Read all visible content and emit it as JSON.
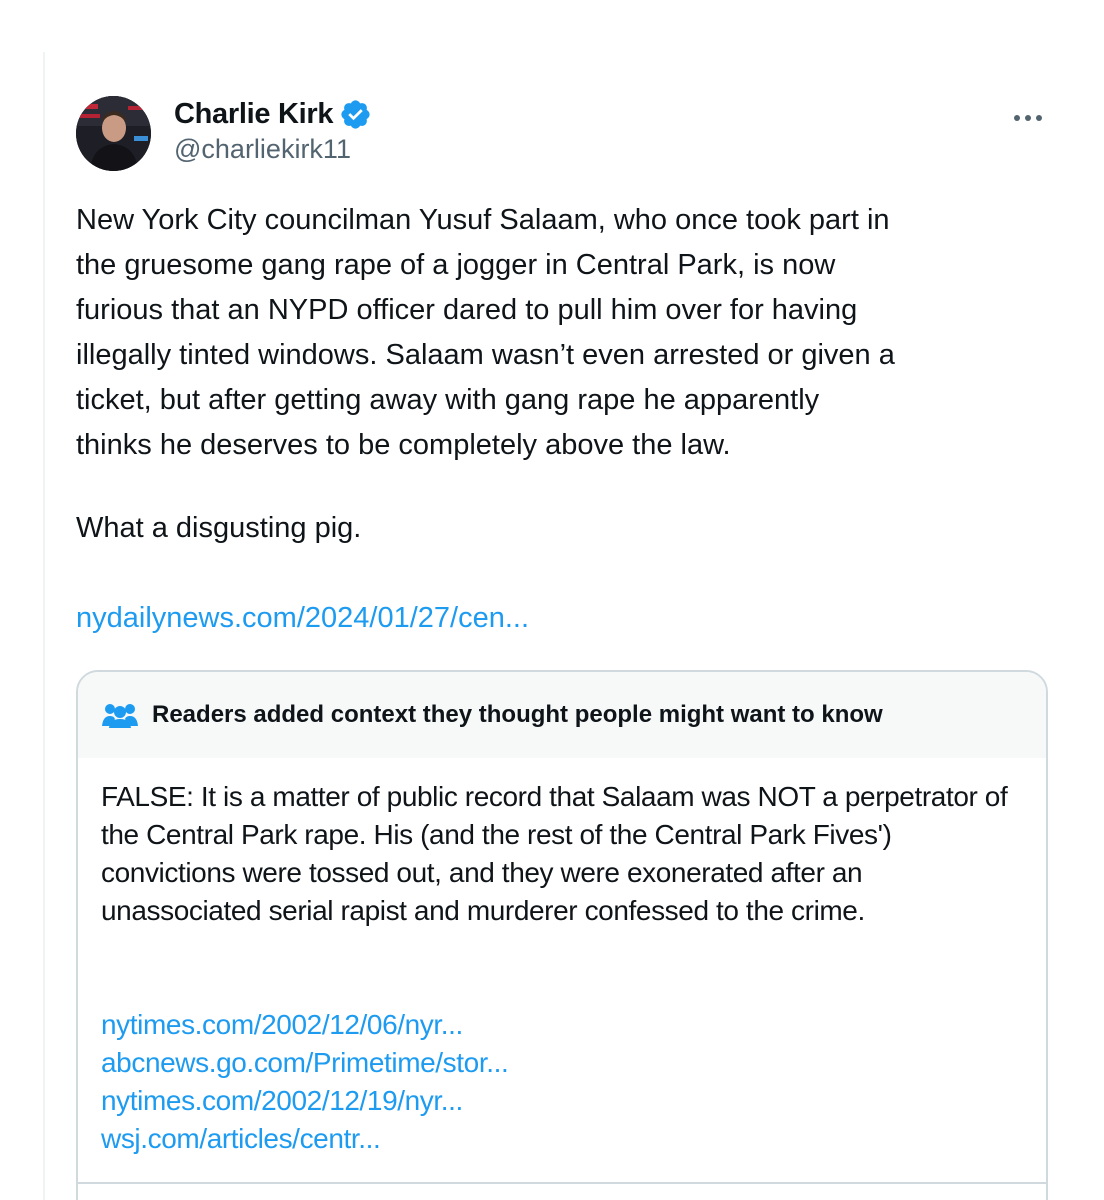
{
  "tweet": {
    "display_name": "Charlie Kirk",
    "handle": "@charliekirk11",
    "more_label": "•••",
    "body": "New York City councilman Yusuf Salaam, who once took part in\nthe gruesome gang rape of a jogger in Central Park, is now\nfurious that an NYPD officer dared to pull him over for having\nillegally tinted windows. Salaam wasn’t even arrested or given a\nticket, but after getting away with gang rape he apparently\nthinks he deserves to be completely above the law.",
    "closing": "What a disgusting pig.",
    "link": "nydailynews.com/2024/01/27/cen..."
  },
  "community_note": {
    "title": "Readers added context they thought people might want to know",
    "body": "FALSE: It is a matter of public record that Salaam was NOT a perpetrator of the Central Park rape. His (and the rest of the Central Park Fives') convictions were tossed out, and they were exonerated after an unassociated serial rapist and murderer confessed to the crime.",
    "sources": [
      "nytimes.com/2002/12/06/nyr...",
      "abcnews.go.com/Primetime/stor...",
      "nytimes.com/2002/12/19/nyr...",
      "wsj.com/articles/centr..."
    ]
  },
  "colors": {
    "link": "#1d9bf0",
    "verified_badge": "#1d9bf0",
    "secondary_text": "#536471",
    "border": "#cfd9de"
  },
  "icons": {
    "verified": "verified-badge-icon",
    "more": "more-options-icon",
    "note": "community-notes-icon"
  }
}
